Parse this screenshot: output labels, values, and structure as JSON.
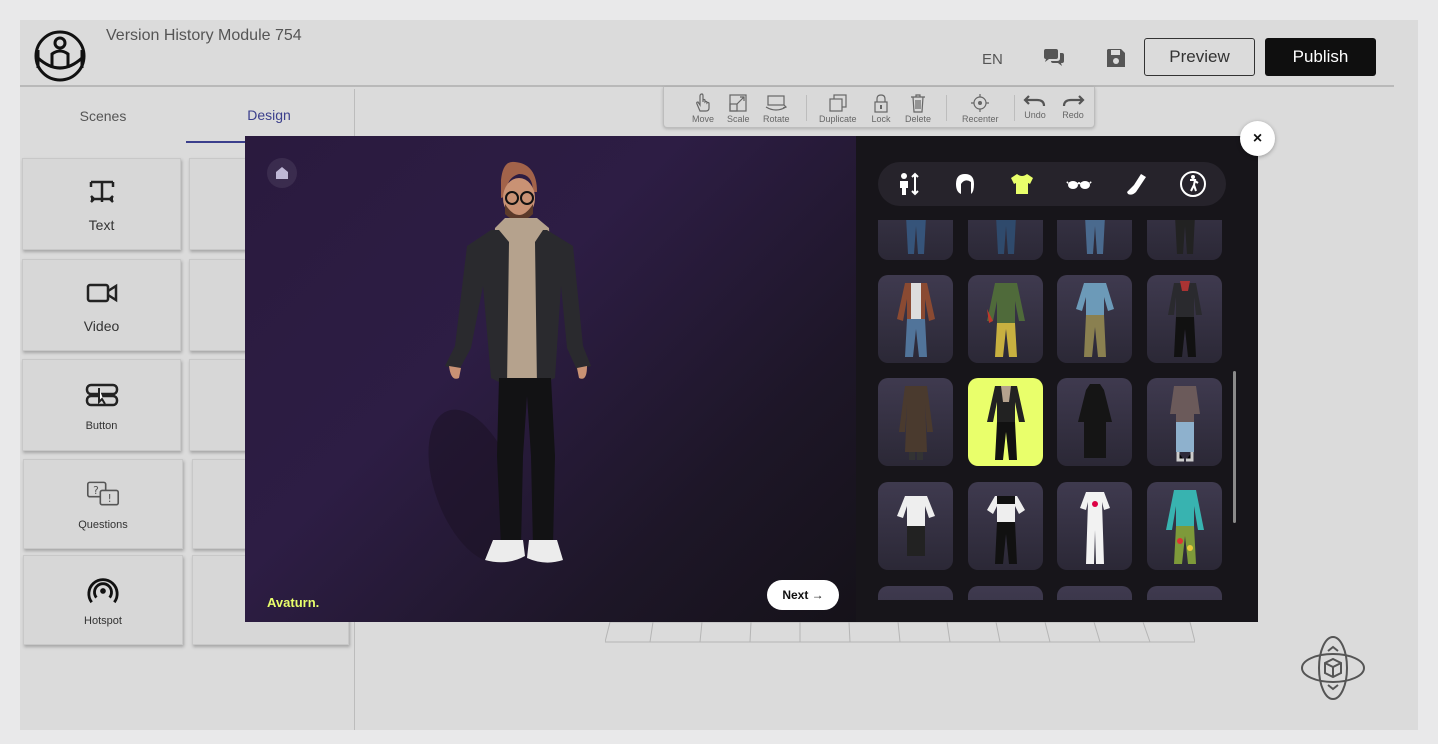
{
  "app": {
    "title": "Version History Module 754"
  },
  "header": {
    "language": "EN",
    "preview_label": "Preview",
    "publish_label": "Publish"
  },
  "left_tabs": [
    {
      "label": "Scenes"
    },
    {
      "label": "Design"
    }
  ],
  "design_tiles": [
    {
      "label": "Text",
      "icon": "text-icon"
    },
    {
      "label": "Video",
      "icon": "video-icon"
    },
    {
      "label": "Button",
      "icon": "button-icon"
    },
    {
      "label": "Questions",
      "icon": "questions-icon"
    },
    {
      "label": "Hotspot",
      "icon": "hotspot-icon"
    }
  ],
  "toolbar": {
    "items": [
      {
        "label": "Move",
        "icon": "hand-icon"
      },
      {
        "label": "Scale",
        "icon": "scale-icon"
      },
      {
        "label": "Rotate",
        "icon": "rotate-icon"
      },
      {
        "label": "Duplicate",
        "icon": "duplicate-icon"
      },
      {
        "label": "Lock",
        "icon": "lock-icon"
      },
      {
        "label": "Delete",
        "icon": "trash-icon"
      },
      {
        "label": "Recenter",
        "icon": "recenter-icon"
      },
      {
        "label": "Undo",
        "icon": "undo-icon"
      },
      {
        "label": "Redo",
        "icon": "redo-icon"
      }
    ]
  },
  "avatar_editor": {
    "brand": "Avaturn.",
    "next_label": "Next →",
    "categories": [
      "body-icon",
      "hair-icon",
      "outfit-icon",
      "glasses-icon",
      "shoes-icon",
      "animation-icon"
    ],
    "active_category": "outfit-icon",
    "selected_outfit_index": 5,
    "accent_color": "#e9ff6b"
  },
  "close_label": "×",
  "colors": {
    "publish_bg": "#0f0f0f",
    "tab_active": "#3b3f8c",
    "panel_dark": "#17151a"
  }
}
